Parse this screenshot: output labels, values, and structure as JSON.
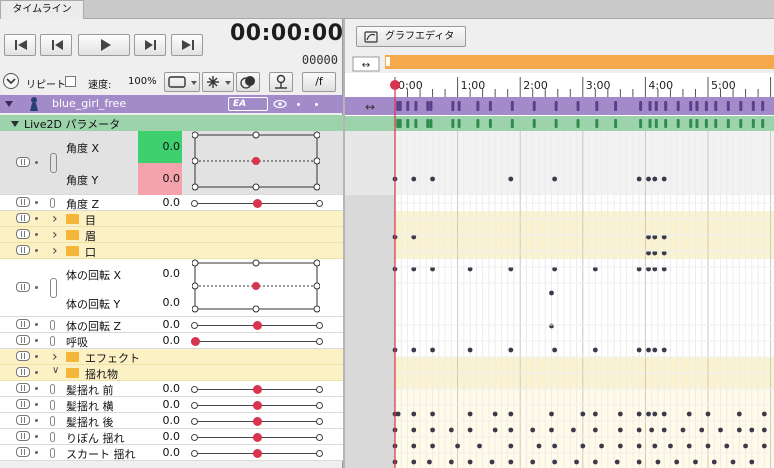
{
  "tab": {
    "label": "タイムライン"
  },
  "transport": {
    "buttons": [
      "skip-to-start",
      "step-back",
      "play",
      "step-forward",
      "skip-to-end"
    ],
    "timecode": "00:00:00",
    "frame": "00000"
  },
  "options": {
    "repeat_label": "リピート",
    "speed_label": "速度:",
    "speed_value": "100%",
    "fps_button": "/f"
  },
  "object": {
    "name": "blue_girl_free",
    "badge": "EA"
  },
  "group": {
    "name": "Live2D パラメータ"
  },
  "params": [
    {
      "name": "角度 X",
      "value": "0.0",
      "kind": "pad-top",
      "color": "#3ecf6f"
    },
    {
      "name": "角度 Y",
      "value": "0.0",
      "kind": "pad-bottom",
      "color": "#f4a3ad"
    },
    {
      "name": "角度 Z",
      "value": "0.0",
      "kind": "slider",
      "knob": 0.5
    },
    {
      "name": "目",
      "kind": "folder"
    },
    {
      "name": "眉",
      "kind": "folder"
    },
    {
      "name": "口",
      "kind": "folder"
    },
    {
      "name": "体の回転 X",
      "value": "0.0",
      "kind": "pad-top"
    },
    {
      "name": "体の回転 Y",
      "value": "0.0",
      "kind": "pad-bottom"
    },
    {
      "name": "体の回転 Z",
      "value": "0.0",
      "kind": "slider",
      "knob": 0.5
    },
    {
      "name": "呼吸",
      "value": "0.0",
      "kind": "slider",
      "knob": 0.0
    },
    {
      "name": "エフェクト",
      "kind": "folder"
    },
    {
      "name": "揺れ物",
      "kind": "folder-open"
    },
    {
      "name": "髪揺れ 前",
      "value": "0.0",
      "kind": "slider",
      "knob": 0.5
    },
    {
      "name": "髪揺れ 横",
      "value": "0.0",
      "kind": "slider",
      "knob": 0.5
    },
    {
      "name": "髪揺れ 後",
      "value": "0.0",
      "kind": "slider",
      "knob": 0.5
    },
    {
      "name": "りぼん 揺れ",
      "value": "0.0",
      "kind": "slider",
      "knob": 0.5
    },
    {
      "name": "スカート 揺れ",
      "value": "0.0",
      "kind": "slider",
      "knob": 0.5
    }
  ],
  "graph_editor": {
    "label": "グラフエディタ"
  },
  "ruler": {
    "labels": [
      "0:00",
      "1:00",
      "2:00",
      "3:00",
      "4:00",
      "5:00"
    ]
  },
  "colors": {
    "accent": "#f5a94a",
    "playhead": "#d9344e",
    "object_bar": "#a38ac9",
    "group_bar": "#9dd3ab"
  }
}
